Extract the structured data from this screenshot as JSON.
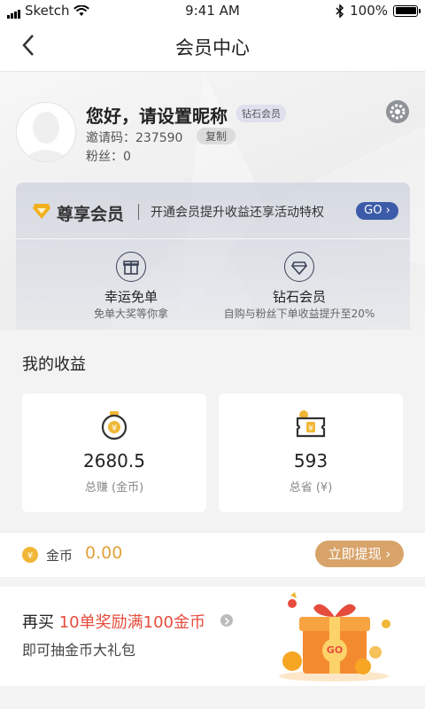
{
  "status_bar": {
    "carrier": "Sketch",
    "time": "9:41 AM",
    "battery": "100%"
  },
  "nav": {
    "title": "会员中心"
  },
  "profile": {
    "nickname": "您好，请设置昵称",
    "badge": "钻石会员",
    "invite_label": "邀请码：",
    "invite_code": "237590",
    "copy_label": "复制",
    "fans_label": "粉丝：",
    "fans_count": "0"
  },
  "vip": {
    "title": "尊享会员",
    "desc": "开通会员提升收益还享活动特权",
    "go_label": "GO",
    "perks": [
      {
        "title": "幸运免单",
        "sub": "免单大奖等你拿",
        "icon": "gift-icon"
      },
      {
        "title": "钻石会员",
        "sub": "自购与粉丝下单收益提升至20%",
        "icon": "diamond-icon"
      }
    ]
  },
  "income": {
    "title": "我的收益",
    "cards": [
      {
        "value": "2680.5",
        "label": "总赚 (金币)",
        "icon": "coin-bag-icon"
      },
      {
        "value": "593",
        "label": "总省 (¥)",
        "icon": "coupon-icon"
      }
    ]
  },
  "coins": {
    "label": "金币",
    "value": "0.00",
    "withdraw_label": "立即提现"
  },
  "promo": {
    "line1_prefix": "再买 ",
    "line1_highlight": "10单奖励满100金币",
    "line2": "即可抽金币大礼包",
    "gift_label": "GO"
  },
  "colors": {
    "accent_gold": "#e0a23b",
    "withdraw_bg": "#d8a46a",
    "go_blue": "#3c5ba9",
    "highlight_red": "#e64c3c"
  }
}
